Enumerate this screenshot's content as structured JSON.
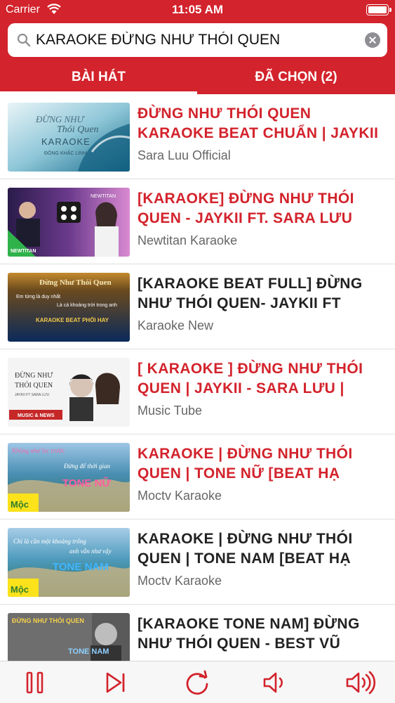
{
  "status_bar": {
    "carrier": "Carrier",
    "time": "11:05 AM"
  },
  "search": {
    "value": "KARAOKE ĐỪNG NHƯ THÓI QUEN",
    "icon": "search-icon",
    "clear_icon": "clear-icon"
  },
  "tabs": [
    {
      "label": "BÀI HÁT",
      "active": true
    },
    {
      "label": "ĐÃ CHỌN (2)",
      "active": false
    }
  ],
  "colors": {
    "accent": "#d3232c",
    "played_title": "#d3232c",
    "default_title": "#222222",
    "channel": "#666666",
    "control": "#d3232c"
  },
  "results": [
    {
      "title": "ĐỪNG NHƯ THÓI QUEN KARAOKE BEAT CHUẨN | JAYKII",
      "channel": "Sara Luu Official",
      "highlighted": true,
      "thumb_text": [
        "ĐỪNG NHƯ",
        "Thói Quen",
        "KARAOKE",
        "ĐÔNG KHẮC LINH"
      ]
    },
    {
      "title": "[KARAOKE] ĐỪNG NHƯ THÓI QUEN - JAYKII FT. SARA LƯU",
      "channel": "Newtitan Karaoke",
      "highlighted": true,
      "thumb_text": [
        "NEWTITAN",
        "NEWTITAN"
      ]
    },
    {
      "title": "[KARAOKE BEAT FULL] ĐỪNG NHƯ THÓI QUEN- JAYKII FT",
      "channel": "Karaoke New",
      "highlighted": false,
      "thumb_text": [
        "Đừng Như Thói Quen",
        "Em từng là duy nhất",
        "Là cả khoảng trời trong anh",
        "KARAOKE BEAT PHỐI HAY"
      ]
    },
    {
      "title": "[ KARAOKE ] ĐỪNG NHƯ THÓI QUEN | JAYKII - SARA LƯU |",
      "channel": "Music Tube",
      "highlighted": true,
      "thumb_text": [
        "ĐỪNG NHƯ",
        "THÓI QUEN",
        "JAYKII FT SARA LƯU",
        "MUSIC & NEWS"
      ]
    },
    {
      "title": "KARAOKE | ĐỪNG NHƯ THÓI QUEN | TONE NỮ [BEAT HẠ",
      "channel": "Moctv Karaoke",
      "highlighted": true,
      "thumb_text": [
        "Không như lúc trước",
        "Đừng để thời gian",
        "TONE NỮ",
        "Mộc"
      ]
    },
    {
      "title": "KARAOKE | ĐỪNG NHƯ THÓI QUEN | TONE NAM [BEAT HẠ",
      "channel": "Moctv Karaoke",
      "highlighted": false,
      "thumb_text": [
        "Chỉ là cần một khoảng trống",
        "anh vẫn như vậy",
        "TONE NAM",
        "Mộc"
      ]
    },
    {
      "title": "[KARAOKE TONE NAM] ĐỪNG NHƯ THÓI QUEN - BEST VŨ",
      "channel": "",
      "highlighted": false,
      "thumb_text": [
        "ĐỪNG NHƯ THÓI QUEN",
        "TONE NAM"
      ]
    }
  ],
  "controls": [
    {
      "name": "pause-button",
      "icon": "pause-icon"
    },
    {
      "name": "next-button",
      "icon": "skip-next-icon"
    },
    {
      "name": "replay-button",
      "icon": "replay-icon"
    },
    {
      "name": "volume-down-button",
      "icon": "volume-low-icon"
    },
    {
      "name": "volume-up-button",
      "icon": "volume-high-icon"
    }
  ]
}
